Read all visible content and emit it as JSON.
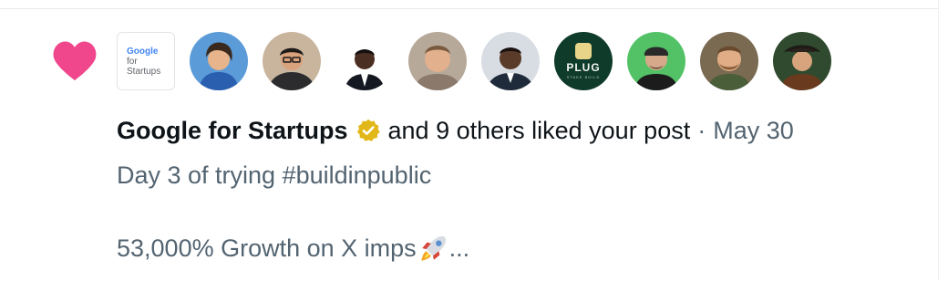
{
  "notification": {
    "actor_name": "Google for Startups",
    "action_text": "and 9 others liked your post",
    "separator": "·",
    "date": "May 30",
    "heart_color": "#f0468c"
  },
  "avatars": [
    {
      "name": "Google for Startups",
      "logo_lines": [
        "Google",
        "for",
        "Startups"
      ]
    },
    {
      "name": "avatar-2"
    },
    {
      "name": "avatar-3"
    },
    {
      "name": "avatar-4"
    },
    {
      "name": "avatar-5"
    },
    {
      "name": "avatar-6"
    },
    {
      "name": "avatar-plug",
      "label": "PLUG",
      "sublabel": "STAKE BUILD"
    },
    {
      "name": "avatar-8"
    },
    {
      "name": "avatar-9"
    },
    {
      "name": "avatar-10"
    }
  ],
  "post": {
    "line1": "Day 3 of trying #buildinpublic",
    "line2": "53,000% Growth on X imps",
    "ellipsis": "..."
  },
  "colors": {
    "primary_text": "#0f1419",
    "secondary_text": "#536471",
    "verified_gold": "#e2b719"
  }
}
